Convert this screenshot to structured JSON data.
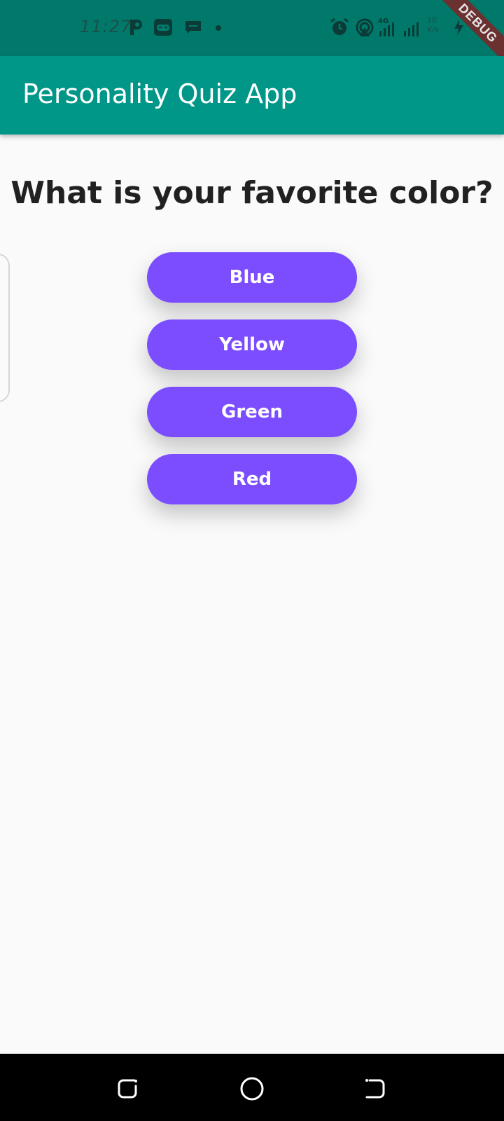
{
  "status_bar": {
    "time": "11:27",
    "speed_text": "10\nK/s",
    "network_label": "4G",
    "icons": [
      "p-icon",
      "game-icon",
      "message-icon",
      "dot-icon",
      "alarm-icon",
      "hotspot-icon",
      "signal-icon",
      "signal-icon",
      "charging-icon",
      "battery-icon"
    ]
  },
  "debug_banner": {
    "label": "DEBUG",
    "color": "#6b3030"
  },
  "app_bar": {
    "title": "Personality Quiz App",
    "color": "#009688"
  },
  "quiz": {
    "question": "What is your favorite color?",
    "answers": [
      "Blue",
      "Yellow",
      "Green",
      "Red"
    ],
    "button_color": "#7c4dff"
  },
  "nav_bar": {
    "icons": [
      "recent-apps-icon",
      "home-icon",
      "back-icon"
    ]
  }
}
